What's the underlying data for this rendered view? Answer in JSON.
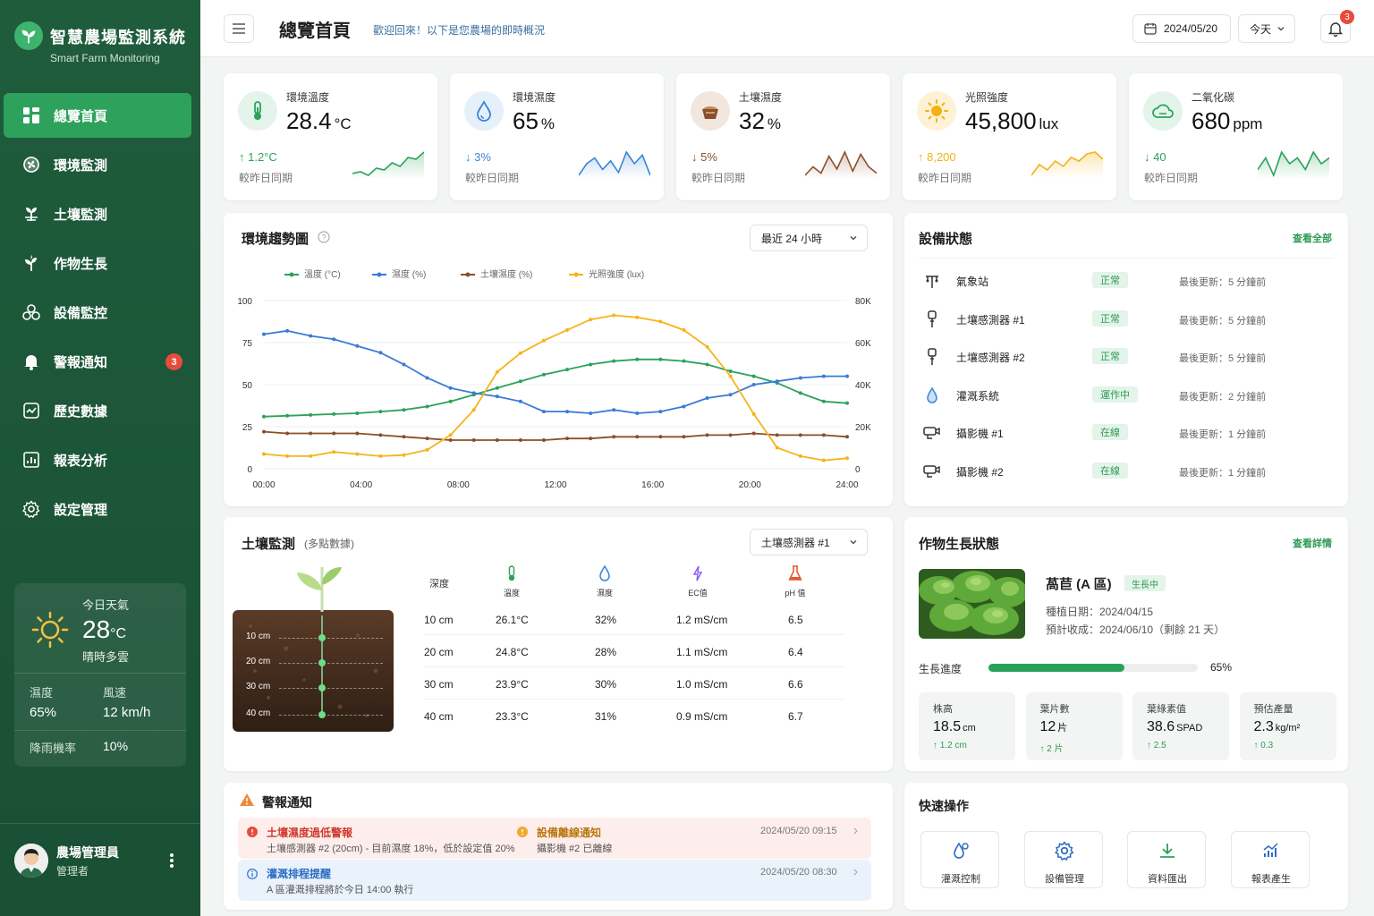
{
  "brand": {
    "title": "智慧農場監測系統",
    "subtitle": "Smart Farm Monitoring"
  },
  "nav": [
    {
      "label": "總覽首頁",
      "icon": "dashboard-icon",
      "active": true
    },
    {
      "label": "環境監測",
      "icon": "fan-icon"
    },
    {
      "label": "土壤監測",
      "icon": "soil-sprout-icon"
    },
    {
      "label": "作物生長",
      "icon": "sprout-icon"
    },
    {
      "label": "設備監控",
      "icon": "devices-icon"
    },
    {
      "label": "警報通知",
      "icon": "bell-icon",
      "badge": "3"
    },
    {
      "label": "歷史數據",
      "icon": "history-chart-icon"
    },
    {
      "label": "報表分析",
      "icon": "report-icon"
    },
    {
      "label": "設定管理",
      "icon": "gear-icon"
    }
  ],
  "weather": {
    "title": "今日天氣",
    "temp": "28",
    "unit": "°C",
    "desc": "晴時多雲",
    "humidity_label": "濕度",
    "humidity": "65%",
    "wind_label": "風速",
    "wind": "12 km/h",
    "rain_label": "降雨機率",
    "rain": "10%"
  },
  "user": {
    "name": "農場管理員",
    "role": "管理者"
  },
  "header": {
    "title": "總覽首頁",
    "subtitle": "歡迎回來！以下是您農場的即時概況",
    "date": "2024/05/20",
    "range": "今天",
    "notif_count": "3"
  },
  "stats": [
    {
      "label": "環境溫度",
      "value": "28.4",
      "unit": "°C",
      "delta": "↑ 1.2°C",
      "compare": "較昨日同期",
      "color": "#2ba25a",
      "icon": "thermometer-icon",
      "spark": [
        6,
        7,
        5,
        9,
        8,
        12,
        10,
        15,
        14,
        18
      ]
    },
    {
      "label": "環境濕度",
      "value": "65",
      "unit": "%",
      "delta": "↓ 3%",
      "compare": "較昨日同期",
      "color": "#3a86d4",
      "icon": "water-drop-icon",
      "spark": [
        8,
        12,
        14,
        10,
        13,
        9,
        16,
        12,
        15,
        8
      ]
    },
    {
      "label": "土壤濕度",
      "value": "32",
      "unit": "%",
      "delta": "↓ 5%",
      "compare": "較昨日同期",
      "color": "#8b4f2b",
      "icon": "soil-pot-icon",
      "spark": [
        5,
        9,
        6,
        14,
        8,
        16,
        7,
        15,
        9,
        6
      ]
    },
    {
      "label": "光照強度",
      "value": "45,800",
      "unit": "lux",
      "delta": "↑ 8,200",
      "compare": "較昨日同期",
      "color": "#f2b312",
      "icon": "sun-icon",
      "spark": [
        4,
        10,
        7,
        12,
        9,
        14,
        12,
        16,
        17,
        13
      ]
    },
    {
      "label": "二氧化碳",
      "value": "680",
      "unit": "ppm",
      "delta": "↓ 40",
      "compare": "較昨日同期",
      "color": "#2ba25a",
      "icon": "cloud-icon",
      "spark": [
        9,
        11,
        8,
        12,
        10,
        11,
        9,
        12,
        10,
        11
      ]
    }
  ],
  "trend": {
    "title": "環境趨勢圖",
    "range": "最近 24 小時"
  },
  "chart_data": {
    "type": "line",
    "x": [
      "00:00",
      "01:00",
      "02:00",
      "03:00",
      "04:00",
      "05:00",
      "06:00",
      "07:00",
      "08:00",
      "09:00",
      "10:00",
      "11:00",
      "12:00",
      "13:00",
      "14:00",
      "15:00",
      "16:00",
      "17:00",
      "18:00",
      "19:00",
      "20:00",
      "21:00",
      "22:00",
      "23:00",
      "24:00"
    ],
    "xticks": [
      "00:00",
      "04:00",
      "08:00",
      "12:00",
      "16:00",
      "20:00",
      "24:00"
    ],
    "yticks_left": [
      "0",
      "25",
      "50",
      "75",
      "100"
    ],
    "yticks_right": [
      "0",
      "20K",
      "40K",
      "60K",
      "80K"
    ],
    "ylim_left": [
      0,
      100
    ],
    "ylim_right": [
      0,
      80000
    ],
    "legend_position": "top",
    "grid": "horizontal",
    "series": [
      {
        "name": "溫度 (°C)",
        "axis": "left",
        "color": "#2ba25a",
        "values": [
          31,
          31.5,
          32,
          32.5,
          33,
          34,
          35,
          37,
          40,
          44,
          48,
          52,
          56,
          59,
          62,
          64,
          65,
          65,
          64,
          62,
          58,
          55,
          51,
          45,
          40,
          39
        ]
      },
      {
        "name": "濕度 (%)",
        "axis": "left",
        "color": "#3a7bd5",
        "values": [
          80,
          82,
          79,
          77,
          73,
          69,
          62,
          54,
          48,
          45,
          43,
          40,
          34,
          34,
          33,
          35,
          33,
          34,
          37,
          42,
          44,
          50,
          52,
          54,
          55,
          55
        ]
      },
      {
        "name": "土壤濕度 (%)",
        "axis": "left",
        "color": "#8b4f2b",
        "values": [
          22,
          21,
          21,
          21,
          21,
          20,
          19,
          18,
          17,
          17,
          17,
          17,
          17,
          18,
          18,
          19,
          19,
          19,
          19,
          20,
          20,
          21,
          20,
          20,
          20,
          19
        ]
      },
      {
        "name": "光照強度 (lux)",
        "axis": "right",
        "color": "#f5b41a",
        "values": [
          7000,
          6000,
          6000,
          8000,
          7000,
          6000,
          6500,
          9000,
          16000,
          28000,
          46000,
          55000,
          61000,
          66000,
          71000,
          73000,
          72000,
          70000,
          66000,
          58000,
          44000,
          26000,
          10000,
          6000,
          4000,
          5000
        ]
      }
    ]
  },
  "devices": {
    "title": "設備狀態",
    "link": "查看全部",
    "items": [
      {
        "name": "氣象站",
        "status": "正常",
        "time": "最後更新：5 分鐘前",
        "icon": "weather-station-icon"
      },
      {
        "name": "土壤感測器 #1",
        "status": "正常",
        "time": "最後更新：5 分鐘前",
        "icon": "soil-sensor-icon"
      },
      {
        "name": "土壤感測器 #2",
        "status": "正常",
        "time": "最後更新：5 分鐘前",
        "icon": "soil-sensor-icon"
      },
      {
        "name": "灌溉系統",
        "status": "運作中",
        "time": "最後更新：2 分鐘前",
        "icon": "irrigation-icon"
      },
      {
        "name": "攝影機 #1",
        "status": "在線",
        "time": "最後更新：1 分鐘前",
        "icon": "camera-icon"
      },
      {
        "name": "攝影機 #2",
        "status": "在線",
        "time": "最後更新：1 分鐘前",
        "icon": "camera-icon"
      }
    ]
  },
  "soil": {
    "title": "土壤監測",
    "subtitle": "(多點數據)",
    "sensor": "土壤感測器 #1",
    "headers": {
      "depth": "深度",
      "temp": "溫度",
      "moisture": "濕度",
      "ec": "EC值",
      "ph": "pH 值"
    },
    "depths": [
      "10 cm",
      "20 cm",
      "30 cm",
      "40 cm"
    ],
    "rows": [
      {
        "depth": "10 cm",
        "temp": "26.1°C",
        "moisture": "32%",
        "ec": "1.2 mS/cm",
        "ph": "6.5"
      },
      {
        "depth": "20 cm",
        "temp": "24.8°C",
        "moisture": "28%",
        "ec": "1.1 mS/cm",
        "ph": "6.4"
      },
      {
        "depth": "30 cm",
        "temp": "23.9°C",
        "moisture": "30%",
        "ec": "1.0 mS/cm",
        "ph": "6.6"
      },
      {
        "depth": "40 cm",
        "temp": "23.3°C",
        "moisture": "31%",
        "ec": "0.9 mS/cm",
        "ph": "6.7"
      }
    ]
  },
  "crop": {
    "title": "作物生長狀態",
    "link": "查看詳情",
    "name": "萵苣 (A 區)",
    "badge": "生長中",
    "planted": "種植日期：2024/04/15",
    "harvest": "預計收成：2024/06/10（剩餘 21 天）",
    "progress_label": "生長進度",
    "progress": 0.65,
    "progress_text": "65%",
    "metrics": [
      {
        "label": "株高",
        "value": "18.5",
        "unit": "cm",
        "delta": "↑ 1.2 cm"
      },
      {
        "label": "葉片數",
        "value": "12",
        "unit": "片",
        "delta": "↑ 2 片"
      },
      {
        "label": "葉綠素值",
        "value": "38.6",
        "unit": "SPAD",
        "delta": "↑ 2.5"
      },
      {
        "label": "預估產量",
        "value": "2.3",
        "unit": "kg/m²",
        "delta": "↑ 0.3"
      }
    ]
  },
  "alerts": {
    "title": "警報通知",
    "items": [
      {
        "title": "土壤濕度過低警報",
        "desc": "土壤感測器 #2 (20cm) - 目前濕度 18%，低於設定值 20%",
        "title2": "設備離線通知",
        "desc2": "攝影機 #2 已離線",
        "time": "2024/05/20 09:15",
        "type": "danger"
      },
      {
        "title": "灌溉排程提醒",
        "desc": "A 區灌溉排程將於今日 14:00 執行",
        "time": "2024/05/20 08:30",
        "type": "info"
      }
    ]
  },
  "quick": {
    "title": "快速操作",
    "items": [
      {
        "label": "灌溉控制",
        "icon": "irrigation-control-icon"
      },
      {
        "label": "設備管理",
        "icon": "gear-icon"
      },
      {
        "label": "資料匯出",
        "icon": "download-icon"
      },
      {
        "label": "報表產生",
        "icon": "report-chart-icon"
      }
    ]
  }
}
